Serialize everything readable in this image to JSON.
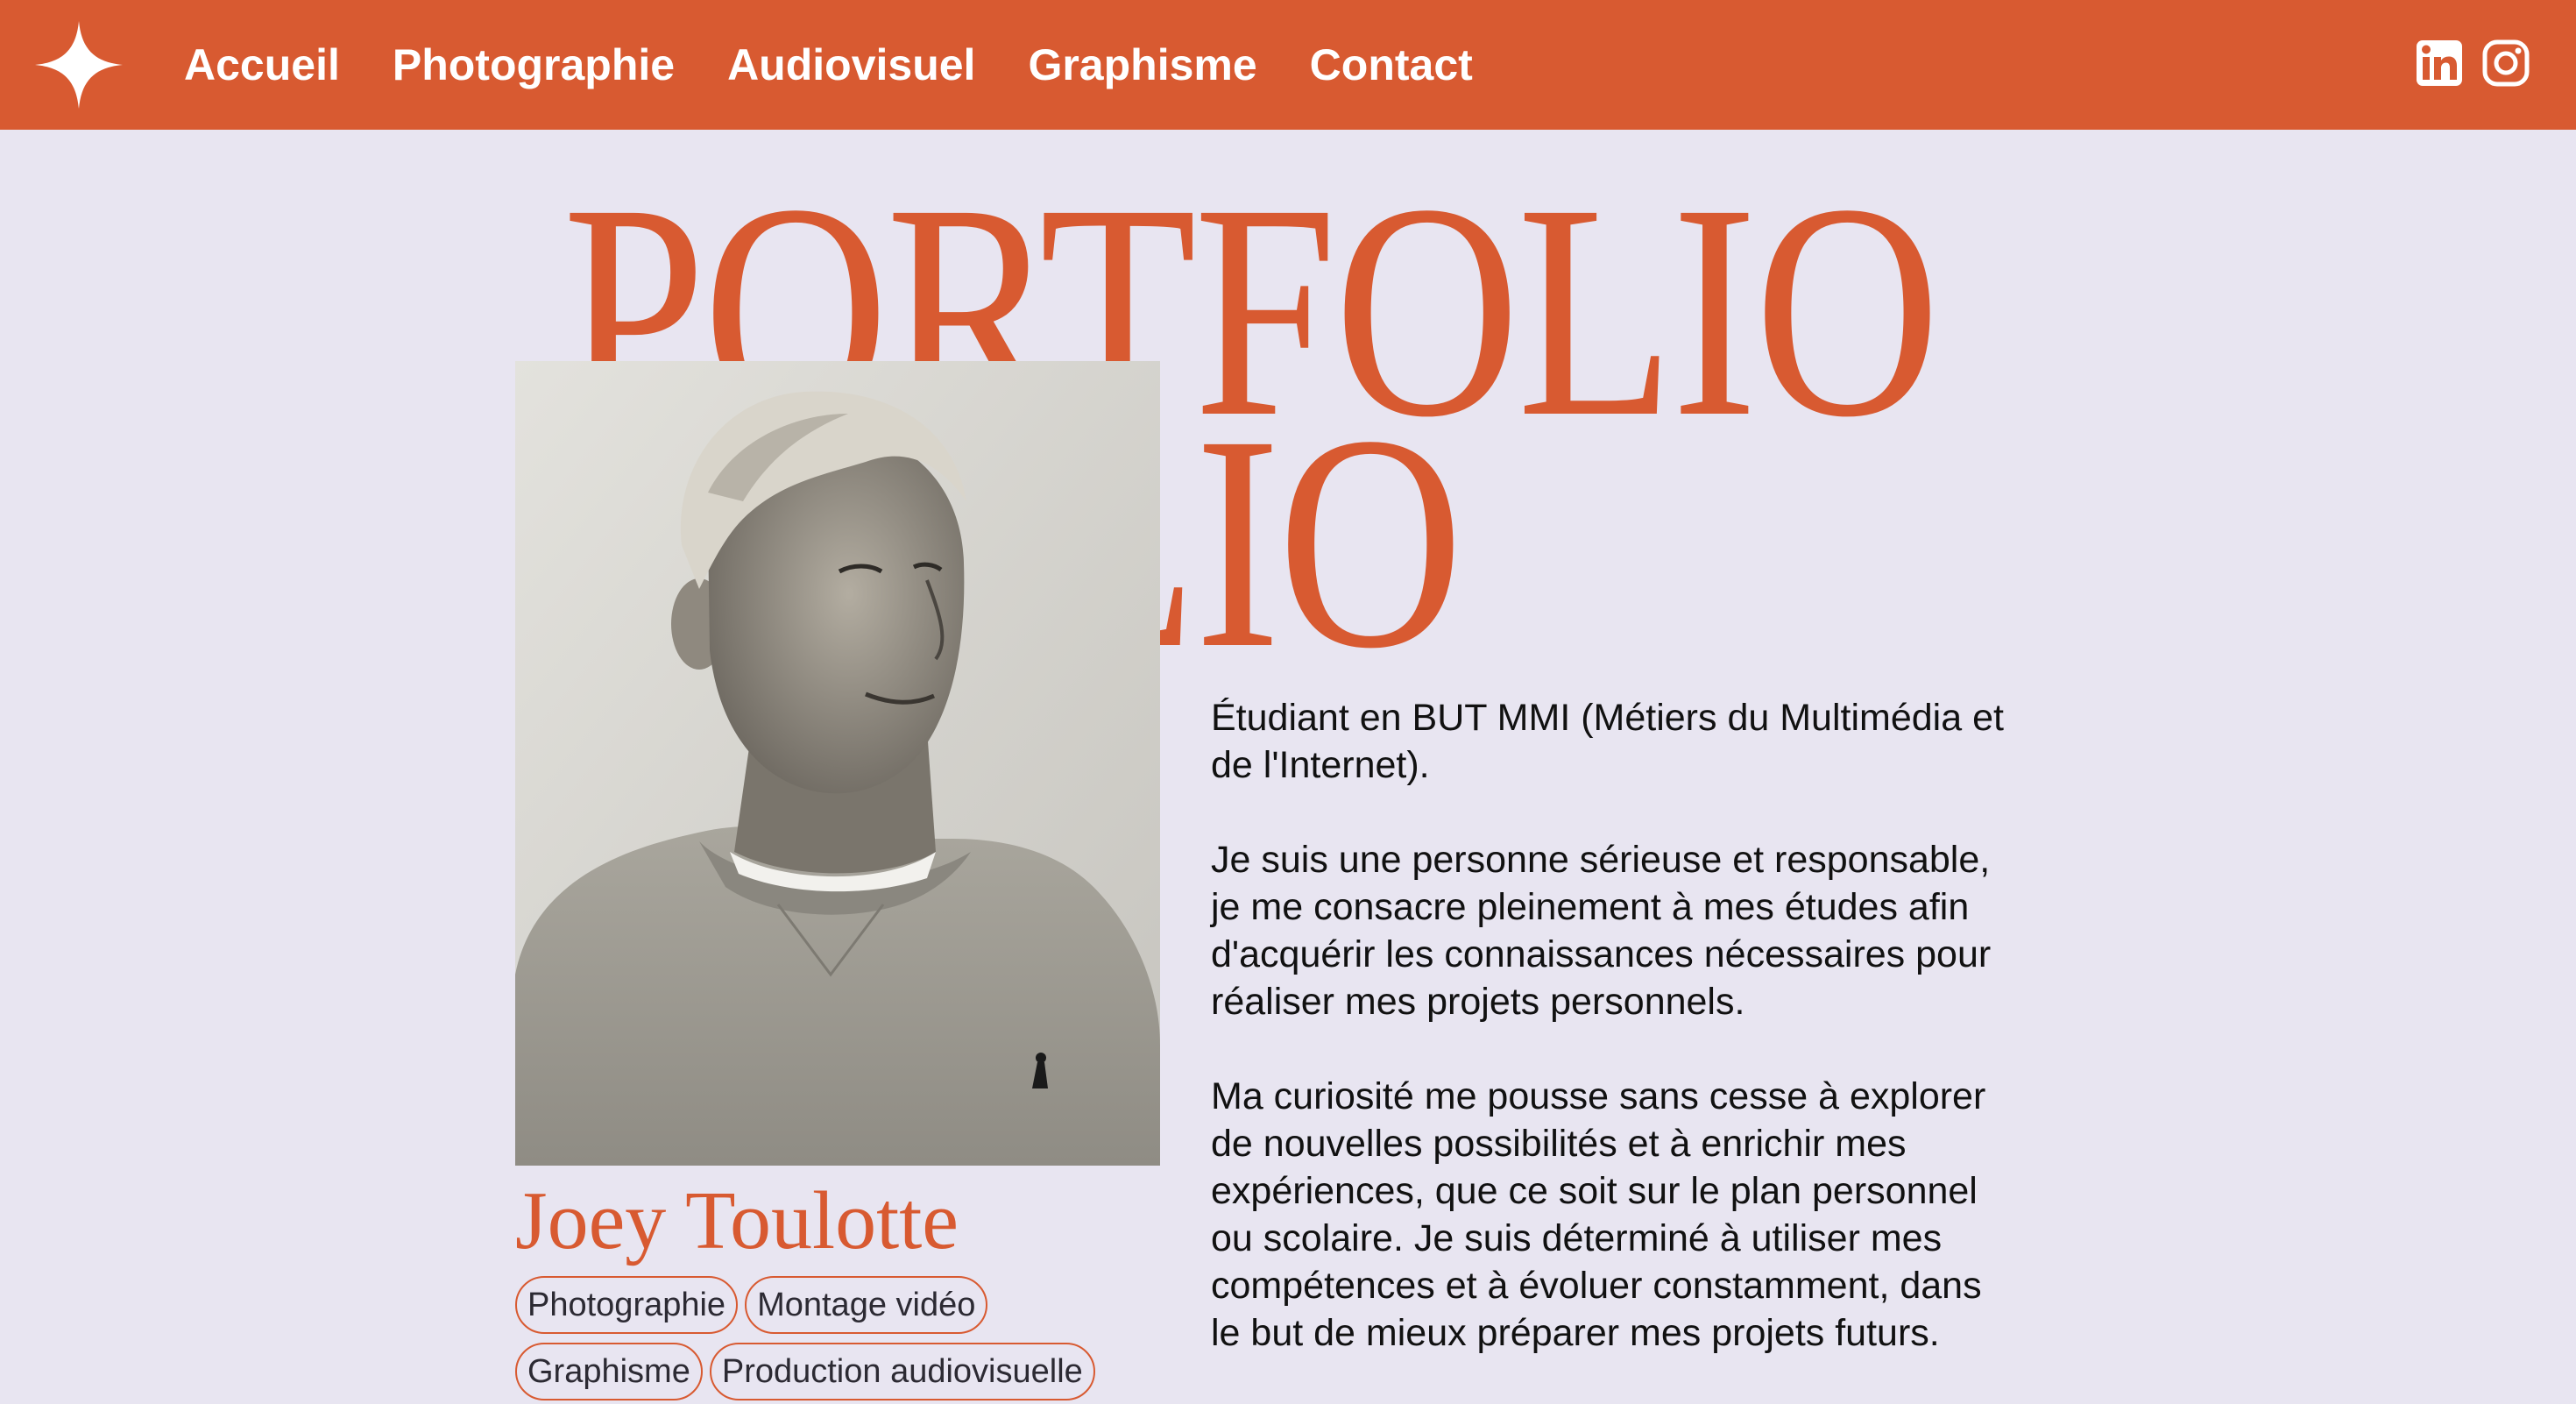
{
  "nav": {
    "logo_icon": "four-point-star-icon",
    "links": [
      {
        "label": "Accueil"
      },
      {
        "label": "Photographie"
      },
      {
        "label": "Audiovisuel"
      },
      {
        "label": "Graphisme"
      },
      {
        "label": "Contact"
      }
    ],
    "social": [
      {
        "icon": "linkedin-icon"
      },
      {
        "icon": "instagram-icon"
      }
    ]
  },
  "hero": {
    "title_line1": "PORTFOLIO",
    "title_line2": "TFOLIO"
  },
  "profile": {
    "name": "Joey Toulotte",
    "tags": [
      "Photographie",
      "Montage vidéo",
      "Graphisme",
      "Production audiovisuelle"
    ]
  },
  "bio": {
    "paragraphs": [
      "Étudiant en BUT MMI (Métiers du Multimédia et\nde l'Internet).",
      "Je suis une personne sérieuse et responsable,\nje me consacre pleinement à mes études afin\nd'acquérir les connaissances nécessaires pour\nréaliser mes projets personnels.",
      "Ma curiosité me pousse sans cesse à explorer\nde nouvelles possibilités et à enrichir mes\nexpériences, que ce soit sur le plan personnel\nou scolaire. Je suis déterminé à utiliser mes\ncompétences et à évoluer constamment, dans\nle but de mieux préparer mes projets futurs."
    ]
  },
  "colors": {
    "accent": "#d85a31",
    "background": "#e8e5f1",
    "text": "#111111"
  }
}
